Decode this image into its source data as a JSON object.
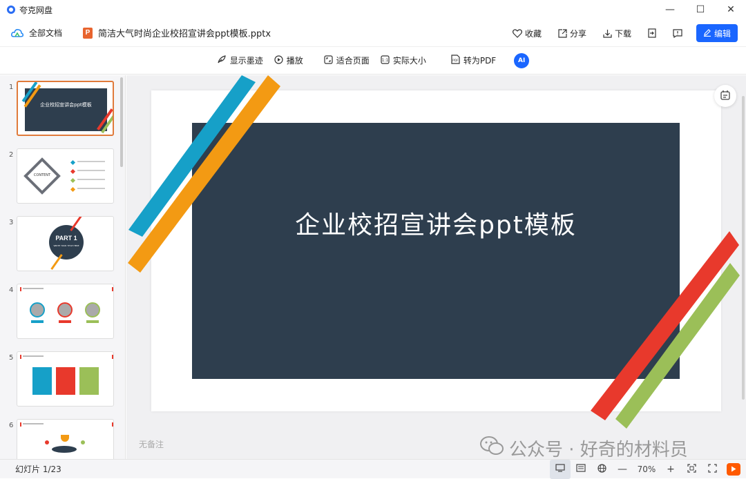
{
  "window": {
    "app_name": "夸克网盘",
    "minimize": "—",
    "maximize": "☐",
    "close": "✕"
  },
  "header": {
    "all_docs": "全部文档",
    "file_icon_letter": "P",
    "filename": "简洁大气时尚企业校招宣讲会ppt模板.pptx",
    "favorite": "收藏",
    "share": "分享",
    "download": "下载",
    "edit": "编辑"
  },
  "toolbar": {
    "show_ink": "显示墨迹",
    "play": "播放",
    "fit_page": "适合页面",
    "actual_size": "实际大小",
    "to_pdf": "转为PDF",
    "ai": "AI"
  },
  "thumbnails": [
    {
      "num": "1",
      "caption": "企业校招宣讲会ppt模板"
    },
    {
      "num": "2",
      "caption": "CONTENT"
    },
    {
      "num": "3",
      "caption": "PART 1",
      "sub": "WRITE YOUR TITLE HERE"
    },
    {
      "num": "4",
      "caption": ""
    },
    {
      "num": "5",
      "caption": ""
    },
    {
      "num": "6",
      "caption": ""
    }
  ],
  "slide": {
    "title": "企业校招宣讲会ppt模板"
  },
  "notes": "无备注",
  "watermark": "公众号 · 好奇的材料员",
  "status": {
    "slide_count": "幻灯片 1/23",
    "zoom": "70%"
  },
  "colors": {
    "accent": "#1a66ff",
    "slide_bg": "#2e3e4e",
    "blue_stripe": "#16a0c8",
    "orange_stripe": "#f39a13",
    "red_stripe": "#e8392c",
    "green_stripe": "#9bbf58"
  }
}
